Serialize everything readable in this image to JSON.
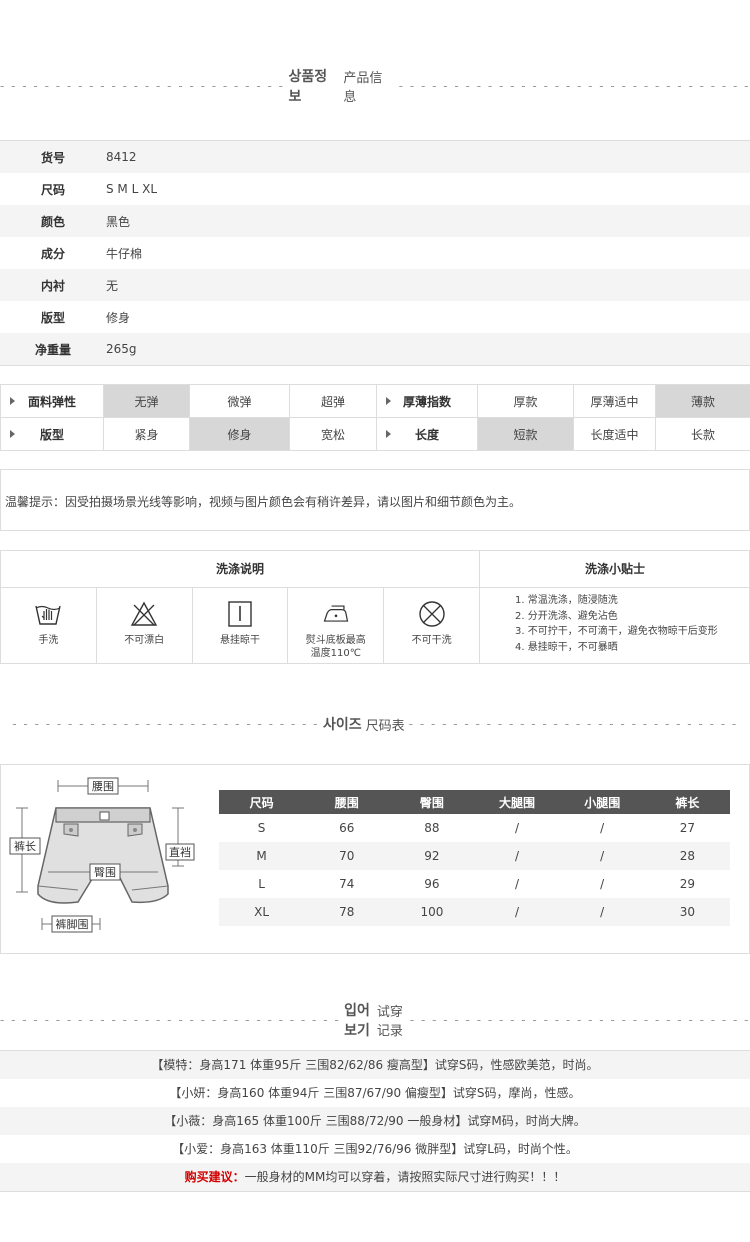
{
  "product_section": {
    "ko": "상품정보",
    "zh": "产品信息"
  },
  "product_info": [
    {
      "key": "货号",
      "value": "8412"
    },
    {
      "key": "尺码",
      "value": "S M L XL"
    },
    {
      "key": "颜色",
      "value": "黑色"
    },
    {
      "key": "成分",
      "value": "牛仔棉"
    },
    {
      "key": "内衬",
      "value": "无"
    },
    {
      "key": "版型",
      "value": "修身"
    },
    {
      "key": "净重量",
      "value": "265g"
    }
  ],
  "attributes": {
    "row1": {
      "head1": "面料弹性",
      "opts1": [
        "无弹",
        "微弹",
        "超弹"
      ],
      "head2": "厚薄指数",
      "opts2": [
        "厚款",
        "厚薄适中",
        "薄款"
      ]
    },
    "row2": {
      "head1": "版型",
      "opts1": [
        "紧身",
        "修身",
        "宽松"
      ],
      "head2": "长度",
      "opts2": [
        "短款",
        "长度适中",
        "长款"
      ]
    },
    "selected": [
      "无弹",
      "薄款",
      "修身",
      "短款"
    ]
  },
  "tip": "温馨提示：因受拍摄场景光线等影响，视频与图片颜色会有稍许差异，请以图片和细节颜色为主。",
  "wash": {
    "title": "洗涤说明",
    "tips_title": "洗涤小贴士",
    "icons": [
      {
        "icon": "hand-wash-icon",
        "label": "手洗"
      },
      {
        "icon": "no-bleach-icon",
        "label": "不可漂白"
      },
      {
        "icon": "hang-dry-icon",
        "label": "悬挂晾干"
      },
      {
        "icon": "iron-icon",
        "label": "熨斗底板最高",
        "label2": "温度110℃"
      },
      {
        "icon": "no-dry-clean-icon",
        "label": "不可干洗"
      }
    ],
    "tips": [
      "1. 常温洗涤，随浸随洗",
      "2. 分开洗涤、避免沾色",
      "3. 不可拧干，不可滴干，避免衣物晾干后变形",
      "4. 悬挂晾干，不可暴晒"
    ]
  },
  "size_section": {
    "ko": "사이즈",
    "zh": "尺码表"
  },
  "diagram_labels": {
    "waist": "腰围",
    "length": "裤长",
    "rise": "直裆",
    "hip": "臀围",
    "hem": "裤脚围"
  },
  "size_table": {
    "headers": [
      "尺码",
      "腰围",
      "臀围",
      "大腿围",
      "小腿围",
      "裤长"
    ],
    "rows": [
      [
        "S",
        "66",
        "88",
        "/",
        "/",
        "27"
      ],
      [
        "M",
        "70",
        "92",
        "/",
        "/",
        "28"
      ],
      [
        "L",
        "74",
        "96",
        "/",
        "/",
        "29"
      ],
      [
        "XL",
        "78",
        "100",
        "/",
        "/",
        "30"
      ]
    ]
  },
  "tryon_section": {
    "ko": "입어보기",
    "zh": "试穿记录"
  },
  "tryon": [
    "【模特：身高171 体重95斤 三围82/62/86 瘦高型】试穿S码，性感欧美范，时尚。",
    "【小妍：身高160 体重94斤 三围87/67/90 偏瘦型】试穿S码，摩尚，性感。",
    "【小薇：身高165 体重100斤 三围88/72/90 一般身材】试穿M码，时尚大牌。",
    "【小爱：身高163 体重110斤 三围92/76/96 微胖型】试穿L码，时尚个性。"
  ],
  "advice": {
    "label": "购买建议：",
    "text": "一般身材的MM均可以穿着，请按照实际尺寸进行购买！！！"
  }
}
